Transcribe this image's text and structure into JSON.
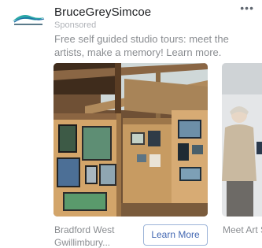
{
  "advertiser": {
    "name": "BruceGreySimcoe",
    "sponsored_label": "Sponsored",
    "more_options_glyph": "•••",
    "logo_icon": "brucegreysimcoe-logo-icon"
  },
  "ad": {
    "text": "Free self guided studio tours: meet the artists, make a memory! Learn more."
  },
  "carousel": {
    "cards": [
      {
        "headline": "Bradford West\nGwillimbury...",
        "cta_label": "Learn More",
        "image_icon": "art-studio-interior-photo"
      },
      {
        "headline": "Meet Art\nSeptemb",
        "image_icon": "artist-people-photo"
      }
    ]
  },
  "colors": {
    "name_text": "#1c1e21",
    "muted_text": "#8a8d91",
    "cta_text": "#4267b2",
    "cta_border": "#9cb4d8"
  }
}
